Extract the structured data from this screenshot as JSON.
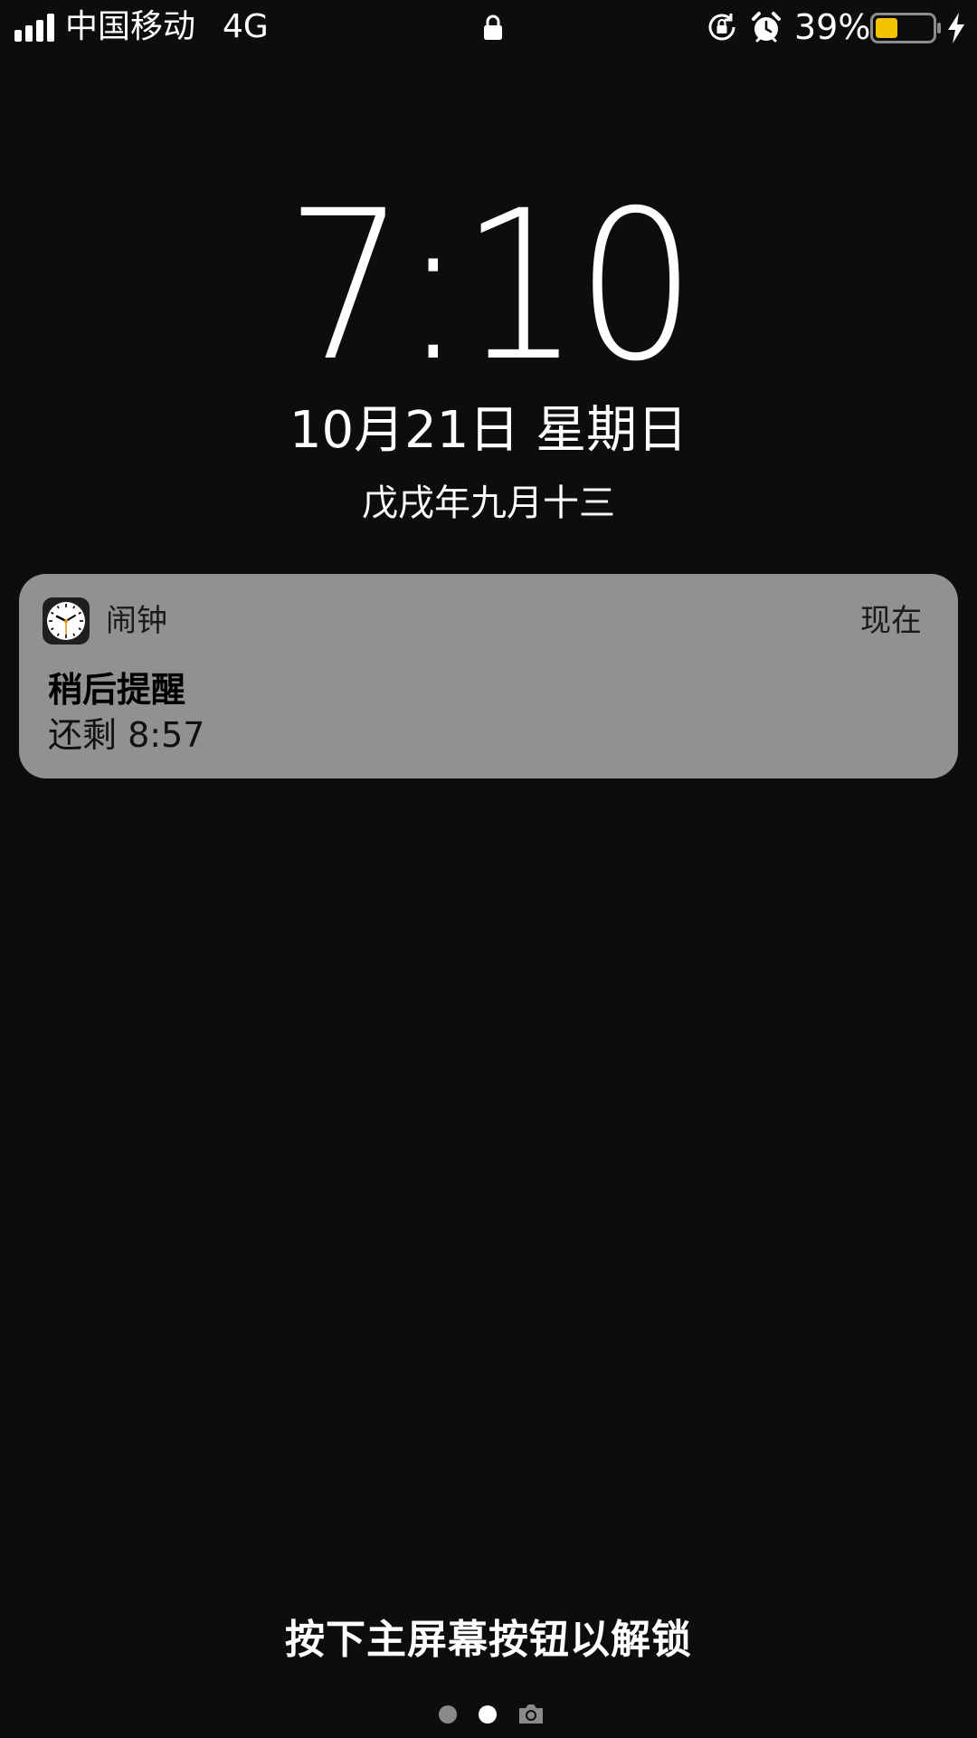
{
  "status_bar": {
    "carrier": "中国移动",
    "network": "4G",
    "battery_percent": "39%",
    "battery_level": 0.39,
    "battery_color": "#f5c400",
    "icons": [
      "signal-icon",
      "lock-icon",
      "rotation-lock-icon",
      "alarm-icon",
      "battery-icon",
      "charging-icon"
    ]
  },
  "lock_screen": {
    "time": "7:10",
    "date": "10月21日 星期日",
    "lunar_date": "戊戌年九月十三"
  },
  "notification": {
    "app_name": "闹钟",
    "time": "现在",
    "title": "稍后提醒",
    "body": "还剩 8:57",
    "app_icon": "clock-icon",
    "background_color": "#919191"
  },
  "bottom": {
    "unlock_hint": "按下主屏幕按钮以解锁",
    "page_indicator": {
      "pages": 2,
      "current": 2,
      "trailing_icon": "camera-icon"
    }
  }
}
